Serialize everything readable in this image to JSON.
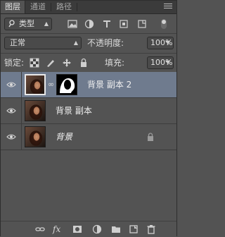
{
  "tabs": [
    "图层",
    "通道",
    "路径"
  ],
  "filter": {
    "search_icon": "search-icon",
    "type_label": "类型",
    "icons": [
      "image-filter-icon",
      "adjustment-filter-icon",
      "text-filter-icon",
      "shape-filter-icon",
      "smart-object-filter-icon"
    ]
  },
  "blend": {
    "mode": "正常",
    "opacity_label": "不透明度:",
    "opacity_value": "100%"
  },
  "lock": {
    "label": "锁定:",
    "icons": [
      "lock-transparent-pixels-icon",
      "lock-image-pixels-icon",
      "lock-position-icon",
      "lock-all-icon"
    ],
    "fill_label": "填充:",
    "fill_value": "100%"
  },
  "layers": [
    {
      "name": "背景 副本 2",
      "has_mask": true,
      "selected": true,
      "locked": false
    },
    {
      "name": "背景 副本",
      "has_mask": false,
      "selected": false,
      "locked": false
    },
    {
      "name": "背景",
      "has_mask": false,
      "selected": false,
      "locked": true,
      "italic": true
    }
  ],
  "bottom_icons": [
    "link-layers-icon",
    "fx-icon",
    "add-mask-icon",
    "adjustment-layer-icon",
    "group-folder-icon",
    "new-layer-icon",
    "trash-icon"
  ],
  "fx_label": "fx",
  "colors": {
    "panel_bg": "#535353",
    "selected_row": "#6f7b8e",
    "tab_bar": "#3b3b3b"
  }
}
